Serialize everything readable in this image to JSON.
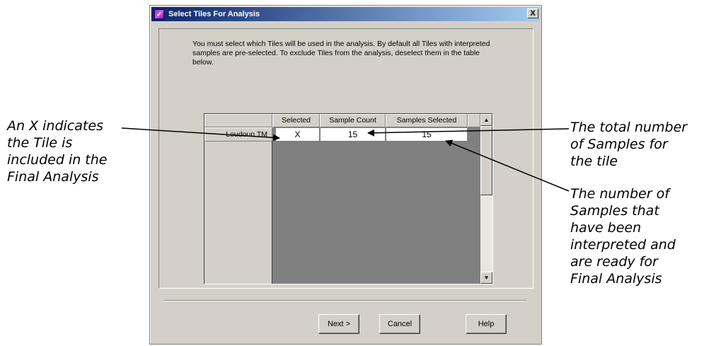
{
  "dialog": {
    "title": "Select Tiles For Analysis",
    "close_label": "X",
    "instructions": "You must select which Tiles will be used in the analysis. By default all Tiles with interpreted samples are pre-selected. To exclude Tiles from the analysis, deselect them in the table below."
  },
  "table": {
    "columns": [
      "Selected",
      "Sample Count",
      "Samples Selected"
    ],
    "rows": [
      {
        "label": "Loudoun TM",
        "selected": "X",
        "sample_count": "15",
        "samples_selected": "15"
      }
    ]
  },
  "buttons": {
    "next": "Next >",
    "cancel": "Cancel",
    "help": "Help"
  },
  "annotations": {
    "left": "An X indicates\nthe Tile is\nincluded in the\nFinal Analysis",
    "top_right": "The total number\nof Samples for\nthe tile",
    "bottom_right": "The number of\nSamples that\nhave been\ninterpreted and\nare ready for\nFinal Analysis"
  }
}
